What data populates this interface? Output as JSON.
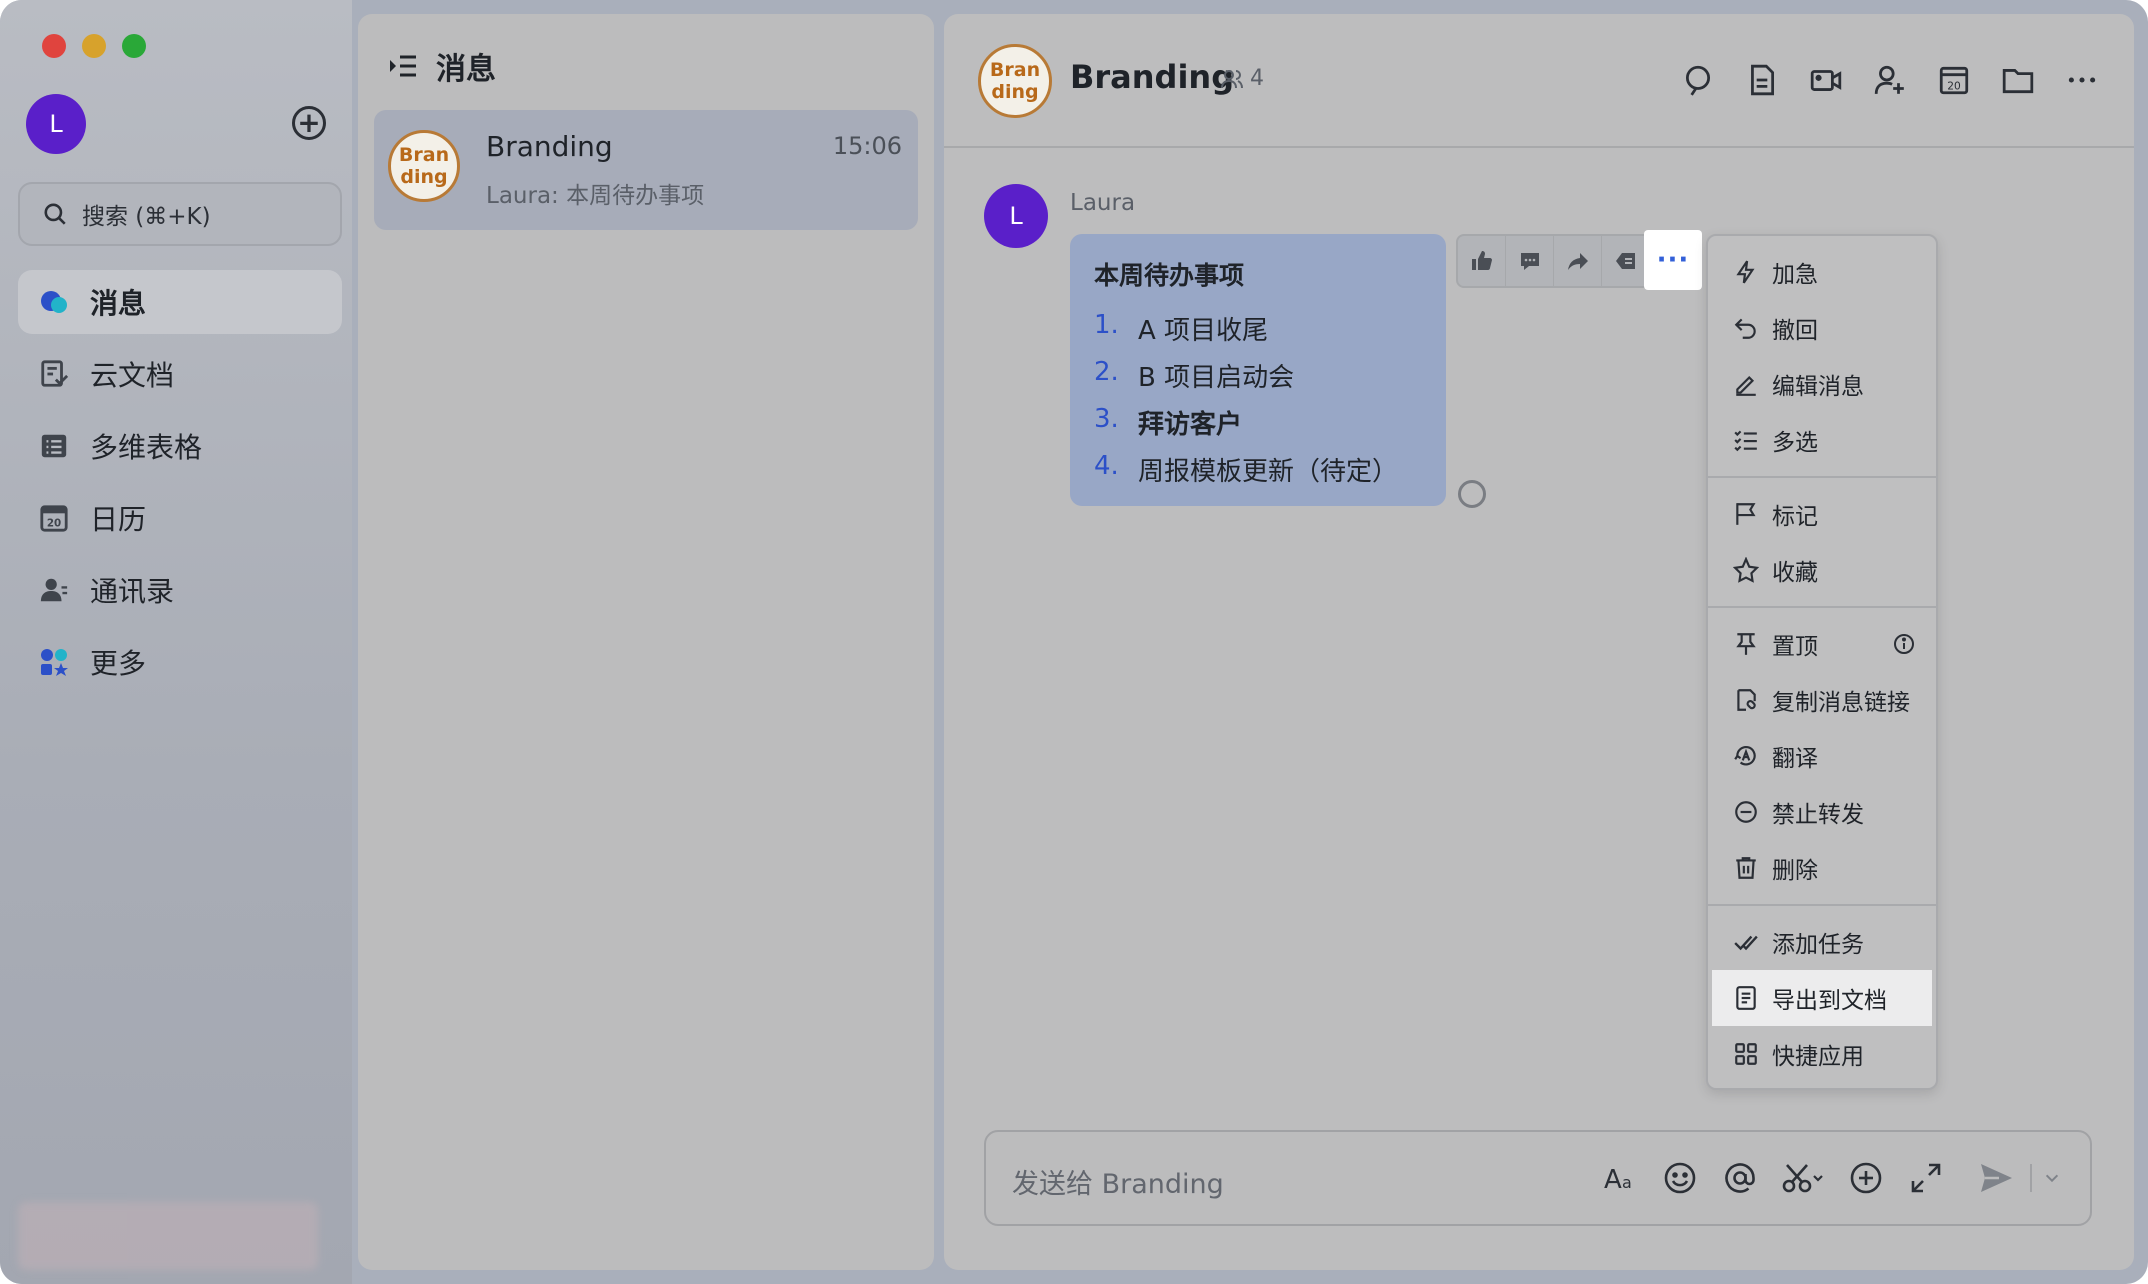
{
  "colors": {
    "accent_blue": "#3360d8",
    "avatar_purple": "#5a1fc9",
    "group_avatar_orange": "#b87a36",
    "traffic_red": "#e0443e",
    "traffic_yellow": "#d7a22c",
    "traffic_green": "#2aa838"
  },
  "sidebar": {
    "user_initial": "L",
    "search_placeholder": "搜索 (⌘+K)",
    "items": [
      {
        "label": "消息",
        "icon": "chat-bubbles-icon",
        "active": true
      },
      {
        "label": "云文档",
        "icon": "cloud-docs-icon",
        "active": false
      },
      {
        "label": "多维表格",
        "icon": "table-icon",
        "active": false
      },
      {
        "label": "日历",
        "icon": "calendar-icon",
        "active": false
      },
      {
        "label": "通讯录",
        "icon": "contacts-icon",
        "active": false
      },
      {
        "label": "更多",
        "icon": "apps-icon",
        "active": false
      }
    ]
  },
  "list": {
    "title": "消息",
    "conversation": {
      "avatar_text": "Bran ding",
      "name": "Branding",
      "time": "15:06",
      "preview": "Laura: 本周待办事项"
    }
  },
  "chat": {
    "avatar_text": "Bran ding",
    "title": "Branding",
    "member_count": "4",
    "message": {
      "sender_initial": "L",
      "sender": "Laura",
      "title": "本周待办事项",
      "todos": [
        {
          "num": "1.",
          "text": "A 项目收尾"
        },
        {
          "num": "2.",
          "text": "B 项目启动会"
        },
        {
          "num": "3.",
          "text": "拜访客户"
        },
        {
          "num": "4.",
          "text": "周报模板更新（待定）"
        }
      ]
    },
    "more_label": "···",
    "menu": {
      "group1": [
        {
          "label": "加急",
          "icon": "bolt-icon"
        },
        {
          "label": "撤回",
          "icon": "undo-icon"
        },
        {
          "label": "编辑消息",
          "icon": "edit-icon"
        },
        {
          "label": "多选",
          "icon": "multi-select-icon"
        }
      ],
      "group2": [
        {
          "label": "标记",
          "icon": "flag-icon"
        },
        {
          "label": "收藏",
          "icon": "star-icon"
        }
      ],
      "group3": [
        {
          "label": "置顶",
          "icon": "pin-icon"
        },
        {
          "label": "复制消息链接",
          "icon": "link-icon"
        },
        {
          "label": "翻译",
          "icon": "translate-icon"
        },
        {
          "label": "禁止转发",
          "icon": "block-forward-icon"
        },
        {
          "label": "删除",
          "icon": "trash-icon"
        }
      ],
      "group4": [
        {
          "label": "添加任务",
          "icon": "task-check-icon"
        },
        {
          "label": "导出到文档",
          "icon": "document-icon",
          "highlighted": true
        },
        {
          "label": "快捷应用",
          "icon": "grid-apps-icon"
        }
      ]
    },
    "input_placeholder": "发送给 Branding"
  }
}
